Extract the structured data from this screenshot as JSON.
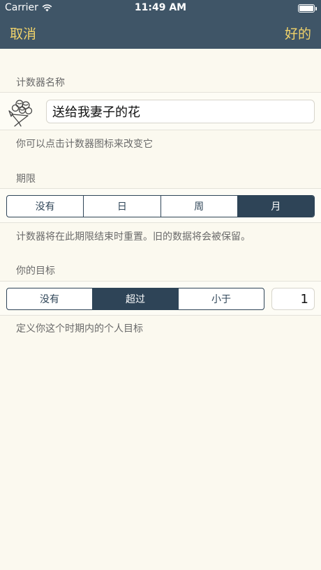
{
  "status": {
    "carrier": "Carrier",
    "time": "11:49 AM"
  },
  "nav": {
    "cancel": "取消",
    "done": "好的"
  },
  "name_section": {
    "header": "计数器名称",
    "value": "送给我妻子的花",
    "icon": "flower-bouquet-icon",
    "footer": "你可以点击计数器图标来改变它"
  },
  "period_section": {
    "header": "期限",
    "options": [
      "没有",
      "日",
      "周",
      "月"
    ],
    "selected": "月",
    "footer": "计数器将在此期限结束时重置。旧的数据将会被保留。"
  },
  "goal_section": {
    "header": "你的目标",
    "options": [
      "没有",
      "超过",
      "小于"
    ],
    "selected": "超过",
    "value": "1",
    "footer": "定义你这个时期内的个人目标"
  },
  "colors": {
    "nav": "#3f5567",
    "accent": "#f1d36a",
    "segment": "#2e4457",
    "background": "#fbf9ef"
  }
}
